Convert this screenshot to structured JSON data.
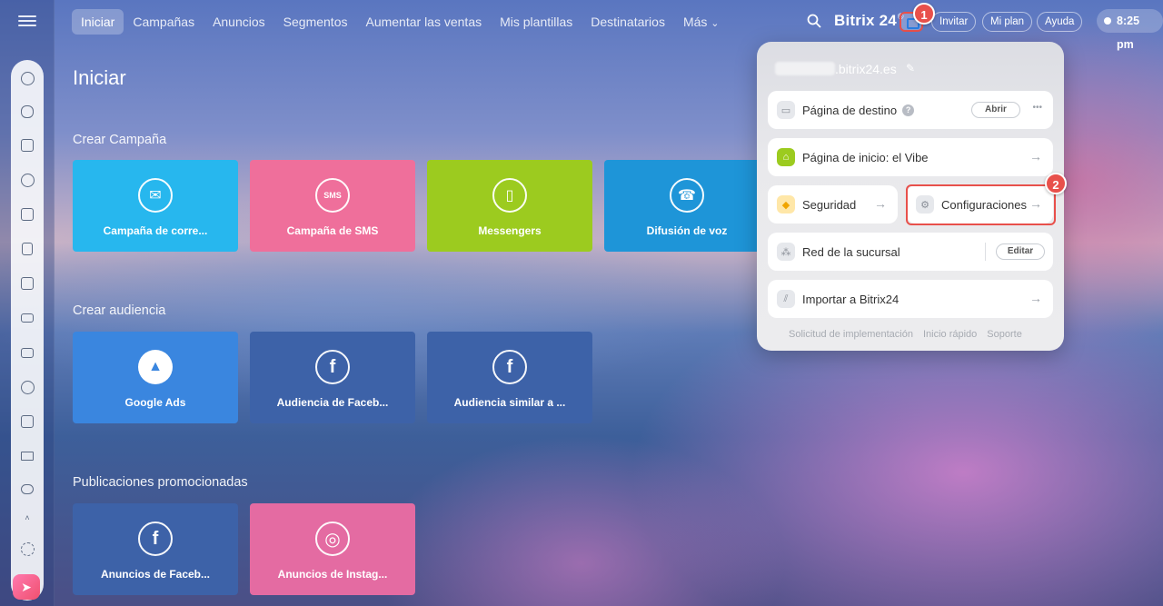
{
  "nav": {
    "items": [
      "Iniciar",
      "Campañas",
      "Anuncios",
      "Segmentos",
      "Aumentar las ventas",
      "Mis plantillas",
      "Destinatarios",
      "Más"
    ],
    "active": 0,
    "more_chevron": "⌄"
  },
  "header": {
    "brand": "Bitrix 24",
    "brand_mark": "©",
    "invite": "Invitar",
    "plan": "Mi plan",
    "help": "Ayuda",
    "clock": "8:25 pm"
  },
  "badges": {
    "one": "1",
    "two": "2"
  },
  "main": {
    "title": "Iniciar",
    "sections": [
      {
        "title": "Crear Campaña",
        "tiles": [
          {
            "label": "Campaña de corre...",
            "icon": "email-icon",
            "glyph": "✉",
            "color": "#27b7ee"
          },
          {
            "label": "Campaña de SMS",
            "icon": "sms-icon",
            "glyph": "SMS",
            "color": "#ef6f9b"
          },
          {
            "label": "Messengers",
            "icon": "phone-icon",
            "glyph": "▯",
            "color": "#9ccb1f"
          },
          {
            "label": "Difusión de voz",
            "icon": "voice-call-icon",
            "glyph": "☎",
            "color": "#1e95d8"
          }
        ]
      },
      {
        "title": "Crear audiencia",
        "tiles": [
          {
            "label": "Google Ads",
            "icon": "google-ads-icon",
            "glyph": "▲",
            "color": "#3a86df"
          },
          {
            "label": "Audiencia de Faceb...",
            "icon": "facebook-icon",
            "glyph": "f",
            "color": "#3d62a8"
          },
          {
            "label": "Audiencia similar a ...",
            "icon": "facebook-icon",
            "glyph": "f",
            "color": "#3d62a8"
          }
        ]
      },
      {
        "title": "Publicaciones promocionadas",
        "tiles": [
          {
            "label": "Anuncios de Faceb...",
            "icon": "facebook-icon",
            "glyph": "f",
            "color": "#3d62a8"
          },
          {
            "label": "Anuncios de Instag...",
            "icon": "instagram-icon",
            "glyph": "◎",
            "color": "#e46ba2"
          }
        ]
      }
    ]
  },
  "popup": {
    "domain": ".bitrix24.es",
    "landing": {
      "label": "Página de destino",
      "help": "?",
      "button": "Abrir",
      "more": "•••"
    },
    "home": {
      "label": "Página de inicio: el Vibe",
      "arrow": "→"
    },
    "security": {
      "label": "Seguridad",
      "arrow": "→"
    },
    "settings": {
      "label": "Configuraciones",
      "arrow": "→"
    },
    "branch": {
      "label": "Red de la sucursal",
      "button": "Editar"
    },
    "import": {
      "label": "Importar a Bitrix24",
      "arrow": "→"
    },
    "footer": [
      "Solicitud de implementación",
      "Inicio rápido",
      "Soporte"
    ]
  }
}
